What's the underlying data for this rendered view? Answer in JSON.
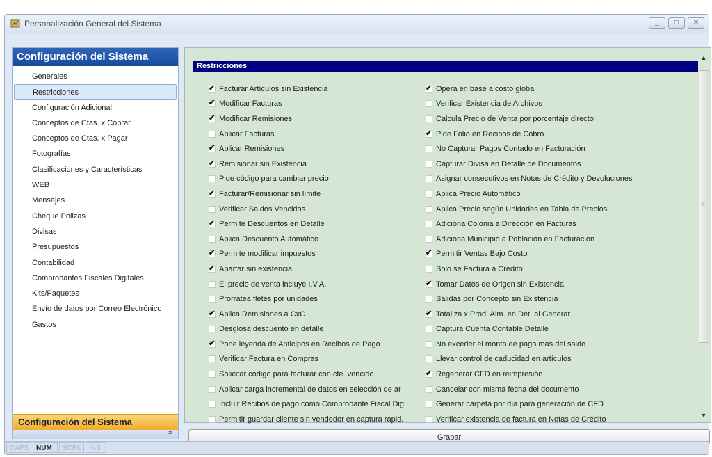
{
  "window": {
    "title": "Personalización General del Sistema",
    "minimize_icon": "minimize-icon",
    "maximize_icon": "maximize-icon",
    "close_icon": "close-icon"
  },
  "sidebar": {
    "header": "Configuración del Sistema",
    "items": [
      {
        "label": "Generales",
        "selected": false
      },
      {
        "label": "Restricciones",
        "selected": true
      },
      {
        "label": "Configuración Adicional",
        "selected": false
      },
      {
        "label": "Conceptos de Ctas. x Cobrar",
        "selected": false
      },
      {
        "label": "Conceptos de Ctas. x Pagar",
        "selected": false
      },
      {
        "label": "Fotografías",
        "selected": false
      },
      {
        "label": "Clasificaciones y Características",
        "selected": false
      },
      {
        "label": "WEB",
        "selected": false
      },
      {
        "label": "Mensajes",
        "selected": false
      },
      {
        "label": "Cheque Polizas",
        "selected": false
      },
      {
        "label": "Divisas",
        "selected": false
      },
      {
        "label": "Presupuestos",
        "selected": false
      },
      {
        "label": "Contabilidad",
        "selected": false
      },
      {
        "label": "Comprobantes Fiscales Digitales",
        "selected": false
      },
      {
        "label": "Kits/Paquetes",
        "selected": false
      },
      {
        "label": "Envío de datos por Correo Electrónico",
        "selected": false
      },
      {
        "label": "Gastos",
        "selected": false
      }
    ],
    "footer_button": "Configuración del Sistema",
    "footer_chevron": "»"
  },
  "panel": {
    "section_title": "Restricciones",
    "left_options": [
      {
        "label": "Facturar Artículos sin Existencia",
        "checked": true
      },
      {
        "label": "Modificar Facturas",
        "checked": true
      },
      {
        "label": "Modificar Remisiones",
        "checked": true
      },
      {
        "label": "Aplicar Facturas",
        "checked": false
      },
      {
        "label": "Aplicar Remisiones",
        "checked": true
      },
      {
        "label": "Remisionar sin Existencia",
        "checked": true
      },
      {
        "label": "Pide código para cambiar precio",
        "checked": false
      },
      {
        "label": "Facturar/Remisionar sin límite",
        "checked": true
      },
      {
        "label": "Verificar Saldos Vencidos",
        "checked": false
      },
      {
        "label": "Permite Descuentos en Detalle",
        "checked": true
      },
      {
        "label": "Aplica Descuento Automático",
        "checked": false
      },
      {
        "label": "Permite modificar impuestos",
        "checked": true
      },
      {
        "label": "Apartar sin existencia",
        "checked": true
      },
      {
        "label": "El precio de venta incluye I.V.A.",
        "checked": false
      },
      {
        "label": "Prorratea fletes por unidades",
        "checked": false
      },
      {
        "label": "Aplica Remisiones a CxC",
        "checked": true
      },
      {
        "label": "Desglosa descuento en detalle",
        "checked": false
      },
      {
        "label": "Pone leyenda de Anticipos en Recibos de Pago",
        "checked": true
      },
      {
        "label": "Verificar Factura en Compras",
        "checked": false
      },
      {
        "label": "Solicitar codigo para facturar con cte. vencido",
        "checked": false
      },
      {
        "label": "Aplicar carga incremental de datos en selección de ar",
        "checked": false
      },
      {
        "label": "Incluir Recibos de pago como Comprobante Fiscal Dig",
        "checked": false
      },
      {
        "label": "Permitir guardar cliente sin vendedor en captura rapid.",
        "checked": false
      }
    ],
    "right_options": [
      {
        "label": "Opera en base a costo global",
        "checked": true
      },
      {
        "label": "Verificar Existencia de Archivos",
        "checked": false
      },
      {
        "label": "Calcula Precio de Venta por porcentaje directo",
        "checked": false
      },
      {
        "label": "Pide Folio en Recibos de Cobro",
        "checked": true
      },
      {
        "label": "No Capturar Pagos Contado en Facturación",
        "checked": false
      },
      {
        "label": "Capturar Divisa en Detalle de Documentos",
        "checked": false
      },
      {
        "label": "Asignar consecutivos en Notas de Crédito y Devoluciones",
        "checked": false
      },
      {
        "label": "Aplica Precio Automático",
        "checked": false
      },
      {
        "label": "Aplica Precio según Unidades en Tabla de Precios",
        "checked": false
      },
      {
        "label": "Adiciona Colonia a Dirección en Facturas",
        "checked": false
      },
      {
        "label": "Adiciona Municipio a Población en Facturación",
        "checked": false
      },
      {
        "label": "Permitir Ventas Bajo Costo",
        "checked": true
      },
      {
        "label": "Solo se Factura a Crédito",
        "checked": false
      },
      {
        "label": "Tomar Datos de Origen sin Existencia",
        "checked": true
      },
      {
        "label": "Salidas por Concepto sin Existencia",
        "checked": false
      },
      {
        "label": "Totaliza x Prod. Alm. en Det. al Generar",
        "checked": true
      },
      {
        "label": "Captura Cuenta Contable Detalle",
        "checked": false
      },
      {
        "label": "No exceder el monto de pago mas del saldo",
        "checked": false
      },
      {
        "label": "Llevar control de caducidad en artículos",
        "checked": false
      },
      {
        "label": "Regenerar CFD en reimpresión",
        "checked": true
      },
      {
        "label": "Cancelar con misma fecha del documento",
        "checked": false
      },
      {
        "label": "Generar carpeta por día para generación de CFD",
        "checked": false
      },
      {
        "label": "Verificar existencia de factura en Notas de Crédito",
        "checked": false
      }
    ],
    "save_label": "Grabar"
  },
  "statusbar": [
    {
      "label": "CAPS",
      "active": false
    },
    {
      "label": "NUM",
      "active": true
    },
    {
      "label": "SCRL",
      "active": false
    },
    {
      "label": "INS",
      "active": false
    }
  ],
  "check_mark": "✔",
  "scroll_up": "▲",
  "scroll_down": "▼"
}
